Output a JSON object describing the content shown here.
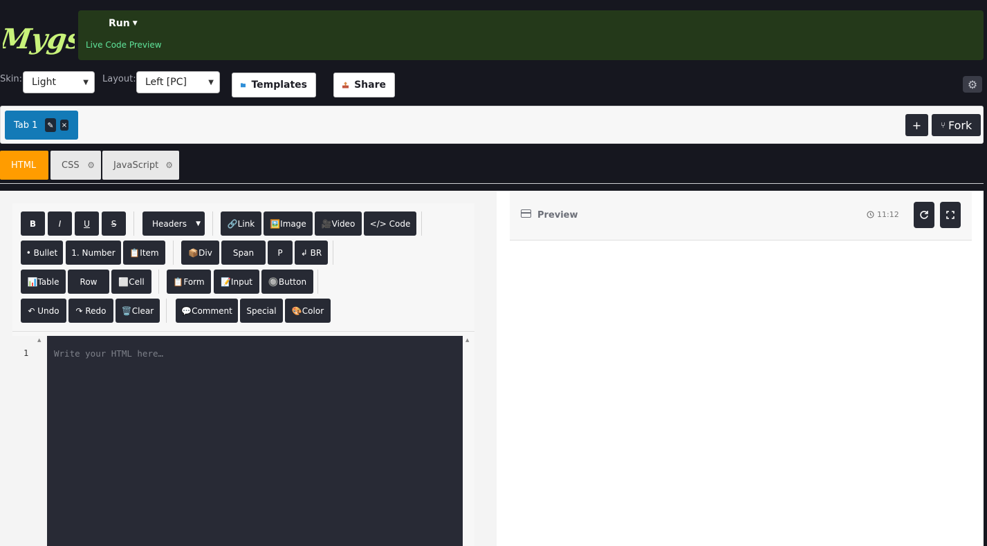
{
  "header": {
    "logo_text": "Mygs",
    "run_label": "Run",
    "live_label": "Live Code Preview"
  },
  "controls": {
    "skin_label": "Skin:",
    "skin_value": "Light",
    "layout_label": "Layout:",
    "layout_value": "Left [PC]",
    "templates_label": "Templates",
    "share_label": "Share"
  },
  "tabs": {
    "tab1_label": "Tab 1",
    "plus_label": "+",
    "fork_label": "Fork"
  },
  "languages": {
    "html": "HTML",
    "css": "CSS",
    "js": "JavaScript"
  },
  "toolbar": {
    "bold": "B",
    "italic": "I",
    "underline": "U",
    "strike": "S",
    "headers": "Headers",
    "link": "🔗Link",
    "image": "🖼️Image",
    "video": "🎥Video",
    "code": "</> Code",
    "bullet": "• Bullet",
    "number": "1. Number",
    "item": "📋Item",
    "div": "📦Div",
    "span": "Span",
    "p": "P",
    "br": "↲ BR",
    "table": "📊Table",
    "row": "Row",
    "cell": "⬜Cell",
    "form": "📋Form",
    "input": "📝Input",
    "button": "🔘Button",
    "undo": "↶ Undo",
    "redo": "↷ Redo",
    "clear": "🗑️Clear",
    "comment": "💬Comment",
    "special": "Special",
    "color": "🎨Color"
  },
  "editor": {
    "line_number": "1",
    "placeholder": "Write your HTML here…"
  },
  "preview": {
    "title": "Preview",
    "time": "11:12"
  },
  "colors": {
    "run_bar": "#24391a",
    "live_text": "#5fe39a",
    "tab_active": "#137ab7",
    "html_tab": "#ff9c00",
    "logo": "#c8f27a"
  }
}
